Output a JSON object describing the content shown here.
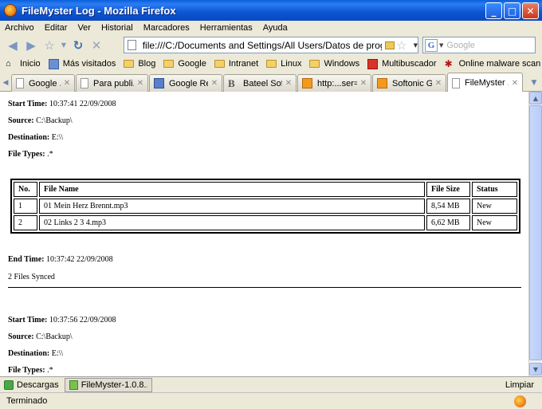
{
  "window": {
    "title": "FileMyster Log - Mozilla Firefox"
  },
  "menu": [
    "Archivo",
    "Editar",
    "Ver",
    "Historial",
    "Marcadores",
    "Herramientas",
    "Ayuda"
  ],
  "nav": {
    "url": "file:///C:/Documents and Settings/All Users/Datos de progr",
    "search_placeholder": "Google"
  },
  "bookmarks": [
    {
      "label": "Inicio",
      "icon": "home-icon"
    },
    {
      "label": "Más visitados",
      "icon": "most-visited-icon"
    },
    {
      "label": "Blog",
      "icon": "folder-icon"
    },
    {
      "label": "Google",
      "icon": "folder-icon"
    },
    {
      "label": "Intranet",
      "icon": "folder-icon"
    },
    {
      "label": "Linux",
      "icon": "folder-icon"
    },
    {
      "label": "Windows",
      "icon": "folder-icon"
    },
    {
      "label": "Multibuscador",
      "icon": "folder-icon"
    },
    {
      "label": "Online malware scan",
      "icon": "malware-scan-icon"
    }
  ],
  "tabs": [
    {
      "label": "Google ...",
      "icon": "page-icon"
    },
    {
      "label": "Para publi...",
      "icon": "page-icon"
    },
    {
      "label": "Google Re...",
      "icon": "reader-icon"
    },
    {
      "label": "Bateel Sof...",
      "icon": "b-icon"
    },
    {
      "label": "http:...ser=",
      "icon": "softonic-icon"
    },
    {
      "label": "Softonic Gl...",
      "icon": "softonic-icon"
    },
    {
      "label": "FileMyster ...",
      "icon": "page-icon"
    }
  ],
  "log": {
    "entry1": {
      "start_label": "Start Time:",
      "start_value": "10:37:41 22/09/2008",
      "source_label": "Source:",
      "source_value": "C:\\Backup\\",
      "dest_label": "Destination:",
      "dest_value": "E:\\\\",
      "types_label": "File Types:",
      "types_value": ".*"
    },
    "table": {
      "headers": [
        "No.",
        "File Name",
        "File Size",
        "Status"
      ],
      "rows": [
        [
          "1",
          "01 Mein Herz Brennt.mp3",
          "8,54 MB",
          "New"
        ],
        [
          "2",
          "02 Links 2 3 4.mp3",
          "6,62 MB",
          "New"
        ]
      ]
    },
    "end_label": "End Time:",
    "end_value": "10:37:42 22/09/2008",
    "synced": "2 Files Synced",
    "entry2": {
      "start_label": "Start Time:",
      "start_value": "10:37:56 22/09/2008",
      "source_label": "Source:",
      "source_value": "C:\\Backup\\",
      "dest_label": "Destination:",
      "dest_value": "E:\\\\",
      "types_label": "File Types:",
      "types_value": ".*"
    }
  },
  "downloads": {
    "label": "Descargas",
    "item": "FileMyster-1.0.8....",
    "clear": "Limpiar"
  },
  "status": {
    "text": "Terminado"
  }
}
